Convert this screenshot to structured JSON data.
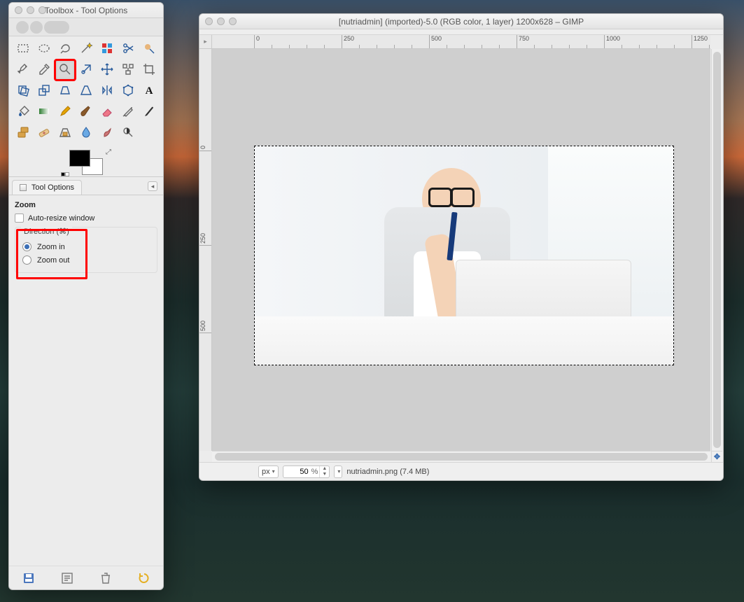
{
  "toolbox": {
    "title": "Toolbox - Tool Options",
    "tools": [
      {
        "n": "rect-select",
        "glyph": "rect"
      },
      {
        "n": "ellipse-select",
        "glyph": "ellipse"
      },
      {
        "n": "free-select",
        "glyph": "lasso"
      },
      {
        "n": "fuzzy-select",
        "glyph": "wand"
      },
      {
        "n": "by-color-select",
        "glyph": "bycolor"
      },
      {
        "n": "scissors",
        "glyph": "scissors"
      },
      {
        "n": "foreground-select",
        "glyph": "fgsel"
      },
      {
        "n": "paths",
        "glyph": "pen"
      },
      {
        "n": "color-picker",
        "glyph": "dropper"
      },
      {
        "n": "zoom",
        "glyph": "zoom",
        "selected": true,
        "highlight": true
      },
      {
        "n": "measure",
        "glyph": "measure"
      },
      {
        "n": "move",
        "glyph": "move"
      },
      {
        "n": "align",
        "glyph": "align"
      },
      {
        "n": "crop",
        "glyph": "crop"
      },
      {
        "n": "rotate",
        "glyph": "rotate"
      },
      {
        "n": "scale",
        "glyph": "scale"
      },
      {
        "n": "shear",
        "glyph": "shear"
      },
      {
        "n": "perspective",
        "glyph": "persp"
      },
      {
        "n": "flip",
        "glyph": "flip"
      },
      {
        "n": "cage",
        "glyph": "cage"
      },
      {
        "n": "text",
        "glyph": "text"
      },
      {
        "n": "bucket-fill",
        "glyph": "bucket"
      },
      {
        "n": "blend",
        "glyph": "blend"
      },
      {
        "n": "pencil",
        "glyph": "pencil"
      },
      {
        "n": "paintbrush",
        "glyph": "brush"
      },
      {
        "n": "eraser",
        "glyph": "eraser"
      },
      {
        "n": "airbrush",
        "glyph": "air"
      },
      {
        "n": "ink",
        "glyph": "ink"
      },
      {
        "n": "clone",
        "glyph": "clone"
      },
      {
        "n": "heal",
        "glyph": "heal"
      },
      {
        "n": "perspective-clone",
        "glyph": "pclone"
      },
      {
        "n": "blur-sharpen",
        "glyph": "blur"
      },
      {
        "n": "smudge",
        "glyph": "smudge"
      },
      {
        "n": "dodge-burn",
        "glyph": "dodge"
      }
    ],
    "tab_label": "Tool Options",
    "section": "Zoom",
    "auto_resize": "Auto-resize window",
    "direction_label": "Direction  (⌘)",
    "zoom_in": "Zoom in",
    "zoom_out": "Zoom out",
    "bottom_icons": [
      "save-options",
      "restore-options",
      "delete-options",
      "reset-options"
    ]
  },
  "imgwin": {
    "title": "[nutriadmin] (imported)-5.0 (RGB color, 1 layer) 1200x628 – GIMP",
    "ruler_marks_h": [
      "0",
      "250",
      "500",
      "750",
      "1000",
      "1250"
    ],
    "ruler_marks_v": [
      "0",
      "250",
      "500"
    ],
    "unit": "px",
    "zoom": "50",
    "zoom_suffix": "%",
    "status": "nutriadmin.png (7.4 MB)"
  }
}
